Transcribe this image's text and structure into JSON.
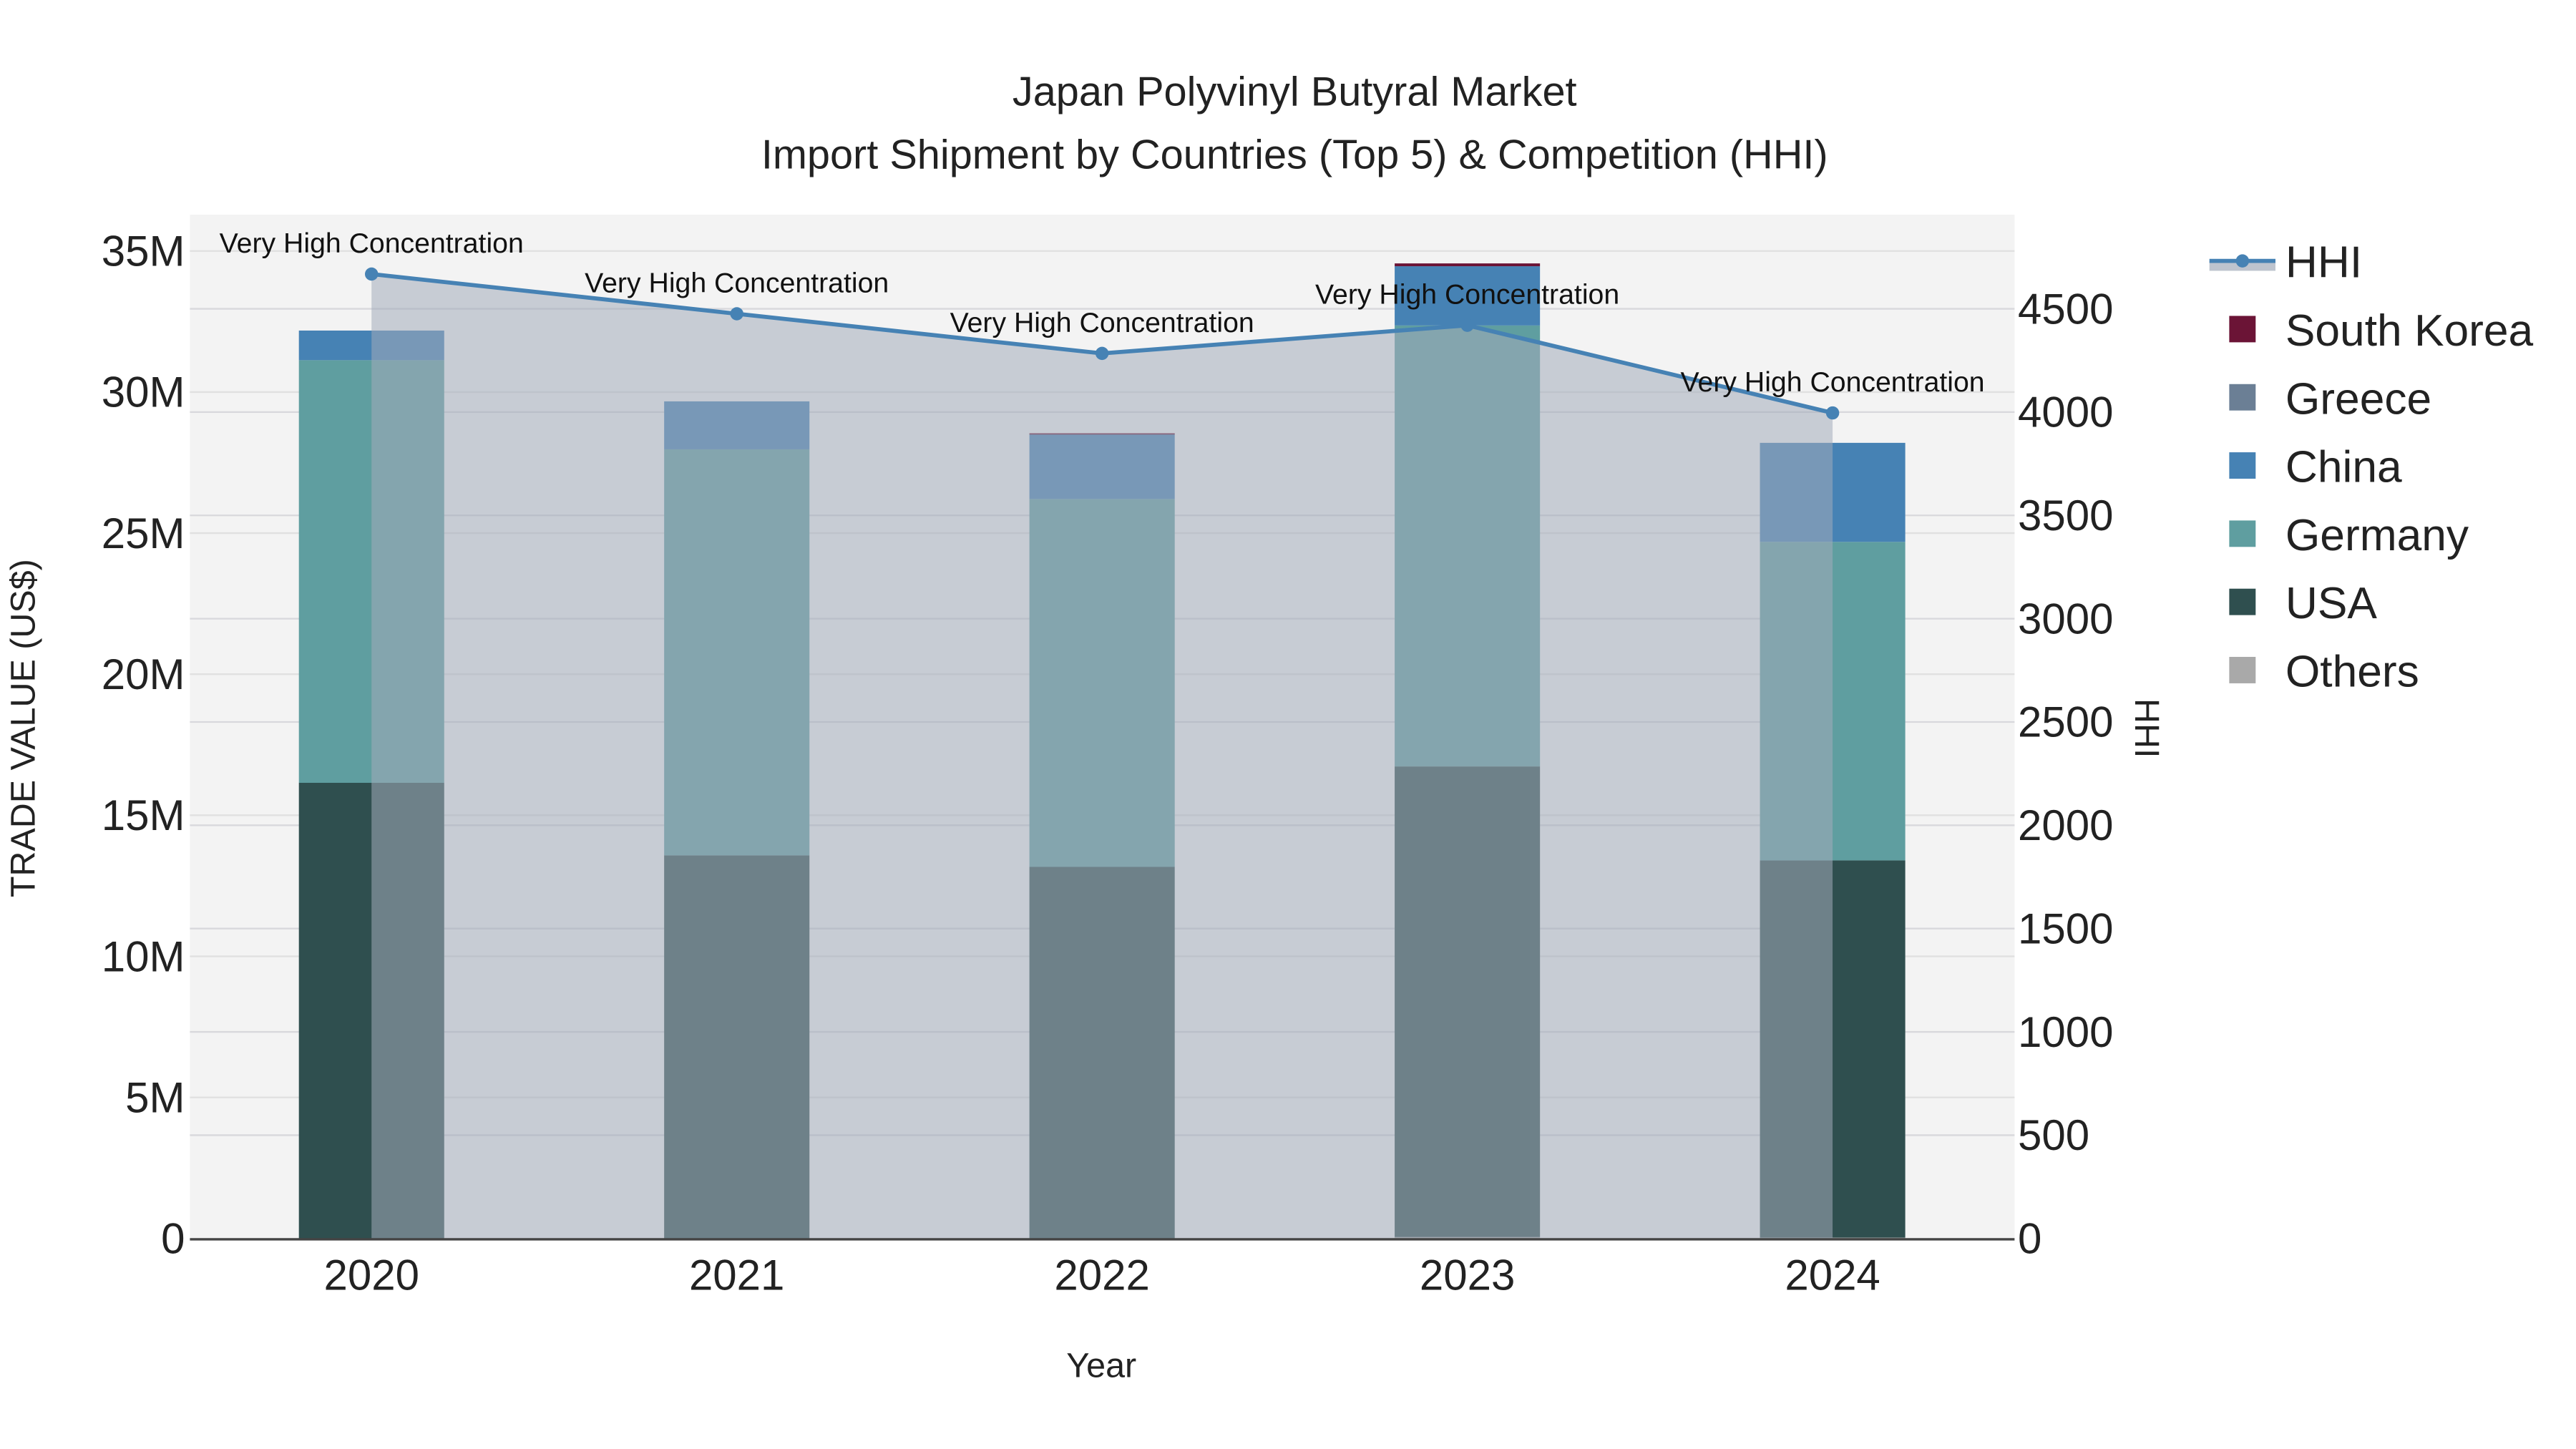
{
  "chart_data": {
    "type": "bar",
    "title_line1": "Japan Polyvinyl Butyral Market",
    "title_line2": "Import Shipment by Countries (Top 5) & Competition (HHI)",
    "xlabel": "Year",
    "ylabel": "TRADE VALUE (US$)",
    "y2label": "HHI",
    "categories": [
      "2020",
      "2021",
      "2022",
      "2023",
      "2024"
    ],
    "ylim": [
      0,
      36000000
    ],
    "y_ticks": [
      0,
      5000000,
      10000000,
      15000000,
      20000000,
      25000000,
      30000000,
      35000000
    ],
    "y_tick_labels": [
      "0",
      "5M",
      "10M",
      "15M",
      "20M",
      "25M",
      "30M",
      "35M"
    ],
    "y2lim": [
      0,
      4960
    ],
    "y2_ticks": [
      0,
      500,
      1000,
      1500,
      2000,
      2500,
      3000,
      3500,
      4000,
      4500
    ],
    "y2_tick_labels": [
      "0",
      "500",
      "1000",
      "1500",
      "2000",
      "2500",
      "3000",
      "3500",
      "4000",
      "4500"
    ],
    "series": [
      {
        "name": "Others",
        "color": "#a9a9a9",
        "values": [
          0,
          0,
          0,
          50000,
          30000
        ]
      },
      {
        "name": "USA",
        "color": "#2f4f4f",
        "values": [
          16150000,
          13580000,
          13170000,
          16680000,
          13370000
        ]
      },
      {
        "name": "Germany",
        "color": "#5f9ea0",
        "values": [
          14980000,
          14390000,
          13040000,
          15630000,
          11290000
        ]
      },
      {
        "name": "China",
        "color": "#4682b4",
        "values": [
          1050000,
          1700000,
          2300000,
          2100000,
          3510000
        ]
      },
      {
        "name": "Greece",
        "color": "#6b7f95",
        "values": [
          0,
          0,
          0,
          0,
          0
        ]
      },
      {
        "name": "South Korea",
        "color": "#6b1436",
        "values": [
          0,
          0,
          30000,
          100000,
          0
        ]
      }
    ],
    "hhi": {
      "name": "HHI",
      "color": "#4682b4",
      "values": [
        4668,
        4476,
        4284,
        4420,
        3996
      ]
    },
    "annotations": [
      "Very High Concentration",
      "Very High Concentration",
      "Very High Concentration",
      "Very High Concentration",
      "Very High Concentration"
    ],
    "legend_order": [
      "HHI",
      "South Korea",
      "Greece",
      "China",
      "Germany",
      "USA",
      "Others"
    ],
    "legend_placement": "right",
    "grid": true
  }
}
